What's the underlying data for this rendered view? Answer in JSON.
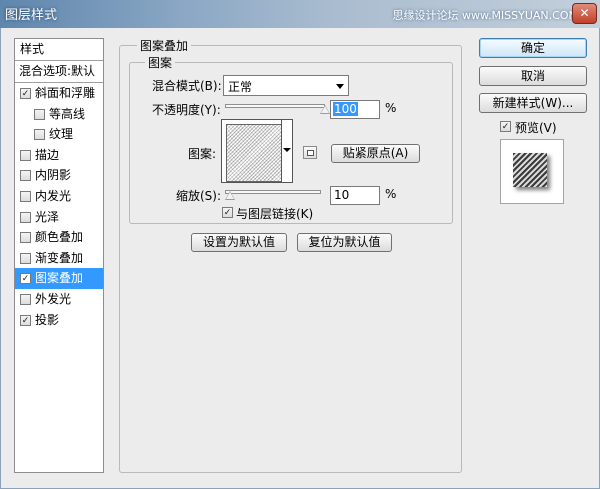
{
  "window": {
    "title": "图层样式",
    "watermark": "思缘设计论坛 www.MISSYUAN.COM",
    "close_glyph": "✕"
  },
  "style_list": {
    "header": "样式",
    "blend_options": "混合选项:默认",
    "items": [
      {
        "label": "斜面和浮雕",
        "checked": true,
        "indent": false,
        "selected": false
      },
      {
        "label": "等高线",
        "checked": false,
        "indent": true,
        "selected": false
      },
      {
        "label": "纹理",
        "checked": false,
        "indent": true,
        "selected": false
      },
      {
        "label": "描边",
        "checked": false,
        "indent": false,
        "selected": false
      },
      {
        "label": "内阴影",
        "checked": false,
        "indent": false,
        "selected": false
      },
      {
        "label": "内发光",
        "checked": false,
        "indent": false,
        "selected": false
      },
      {
        "label": "光泽",
        "checked": false,
        "indent": false,
        "selected": false
      },
      {
        "label": "颜色叠加",
        "checked": false,
        "indent": false,
        "selected": false
      },
      {
        "label": "渐变叠加",
        "checked": false,
        "indent": false,
        "selected": false
      },
      {
        "label": "图案叠加",
        "checked": true,
        "indent": false,
        "selected": true
      },
      {
        "label": "外发光",
        "checked": false,
        "indent": false,
        "selected": false
      },
      {
        "label": "投影",
        "checked": true,
        "indent": false,
        "selected": false
      }
    ]
  },
  "pattern_overlay": {
    "group_title": "图案叠加",
    "subgroup_title": "图案",
    "blend_mode_label": "混合模式(B):",
    "blend_mode_value": "正常",
    "opacity_label": "不透明度(Y):",
    "opacity_value": "100",
    "opacity_level": 1.0,
    "percent": "%",
    "pattern_label": "图案:",
    "snap_origin_button": "贴紧原点(A)",
    "scale_label": "缩放(S):",
    "scale_value": "10",
    "scale_level": 0.0,
    "link_layer_label": "与图层链接(K)",
    "link_layer_checked": true,
    "set_default_button": "设置为默认值",
    "reset_default_button": "复位为默认值"
  },
  "right_buttons": {
    "ok": "确定",
    "cancel": "取消",
    "new_style": "新建样式(W)...",
    "preview_label": "预览(V)",
    "preview_checked": true
  },
  "check_glyph": "✓"
}
